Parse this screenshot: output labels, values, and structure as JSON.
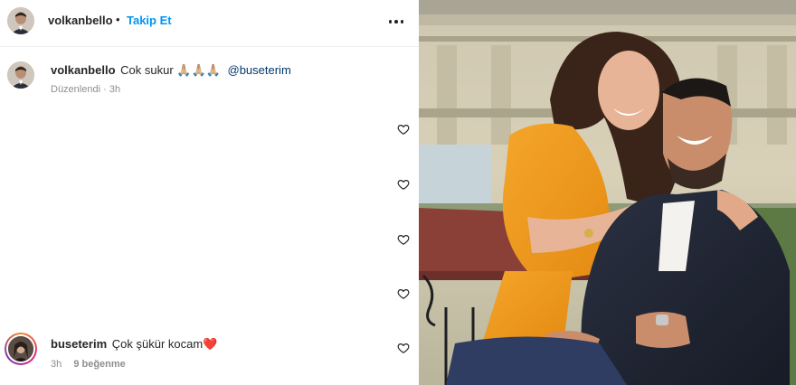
{
  "post": {
    "author": "volkanbello",
    "separator": "•",
    "follow_label": "Takip Et",
    "more_icon": "more-horizontal-icon"
  },
  "caption": {
    "username": "volkanbello",
    "text": "Cok sukur",
    "emoji": "🙏🏼🙏🏼🙏🏼",
    "mention": "@buseterim",
    "edited_label": "Düzenlendi",
    "time": "3h"
  },
  "comment": {
    "username": "buseterim",
    "text": "Çok şükür kocam",
    "emoji": "❤️",
    "time": "3h",
    "likes_label": "9 beğenme"
  },
  "icons": {
    "heart": "heart-outline-icon"
  },
  "colors": {
    "follow_blue": "#0095f6",
    "mention_blue": "#00376b",
    "meta_gray": "#8e8e8e"
  }
}
